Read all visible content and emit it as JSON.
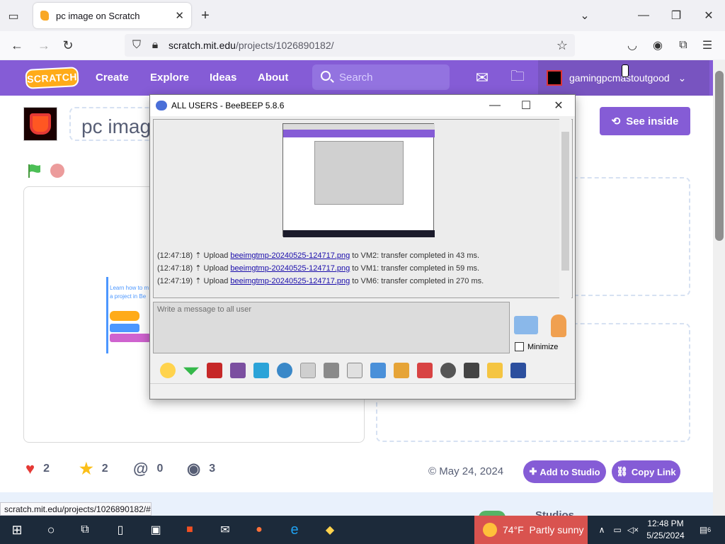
{
  "browser": {
    "tab_title": "pc image on Scratch",
    "url_domain": "scratch.mit.edu",
    "url_path": "/projects/1026890182/",
    "status_url": "scratch.mit.edu/projects/1026890182/#"
  },
  "scratch_nav": {
    "logo": "SCRATCH",
    "links": [
      "Create",
      "Explore",
      "Ideas",
      "About"
    ],
    "search_placeholder": "Search",
    "username": "gamingpcmastoutgood"
  },
  "project": {
    "title": "pc imag",
    "see_inside": "See inside",
    "loves": "2",
    "favorites": "2",
    "remixes": "0",
    "views": "3",
    "date": "May 24, 2024",
    "add_to_studio": "Add to Studio",
    "copy_link": "Copy Link",
    "studios_heading": "Studios",
    "stage_text": "Learn how to m a project in Be"
  },
  "beebeep": {
    "title": "ALL USERS - BeeBEEP 5.8.6",
    "messages": [
      {
        "time": "(12:47:18)",
        "prefix": "Upload",
        "file": "beeimgtmp-20240525-124717.png",
        "suffix": "to VM2: transfer completed in 43 ms."
      },
      {
        "time": "(12:47:18)",
        "prefix": "Upload",
        "file": "beeimgtmp-20240525-124717.png",
        "suffix": "to VM1: transfer completed in 59 ms."
      },
      {
        "time": "(12:47:19)",
        "prefix": "Upload",
        "file": "beeimgtmp-20240525-124717.png",
        "suffix": "to VM6: transfer completed in 270 ms."
      }
    ],
    "input_placeholder": "Write a message to all user",
    "minimize_label": "Minimize"
  },
  "taskbar": {
    "weather_temp": "74°F",
    "weather_text": "Partly sunny",
    "time": "12:48 PM",
    "date": "5/25/2024",
    "notifications": "6"
  },
  "colors": {
    "scratch_purple": "#855cd6",
    "tab_accent": "#ffab19"
  }
}
